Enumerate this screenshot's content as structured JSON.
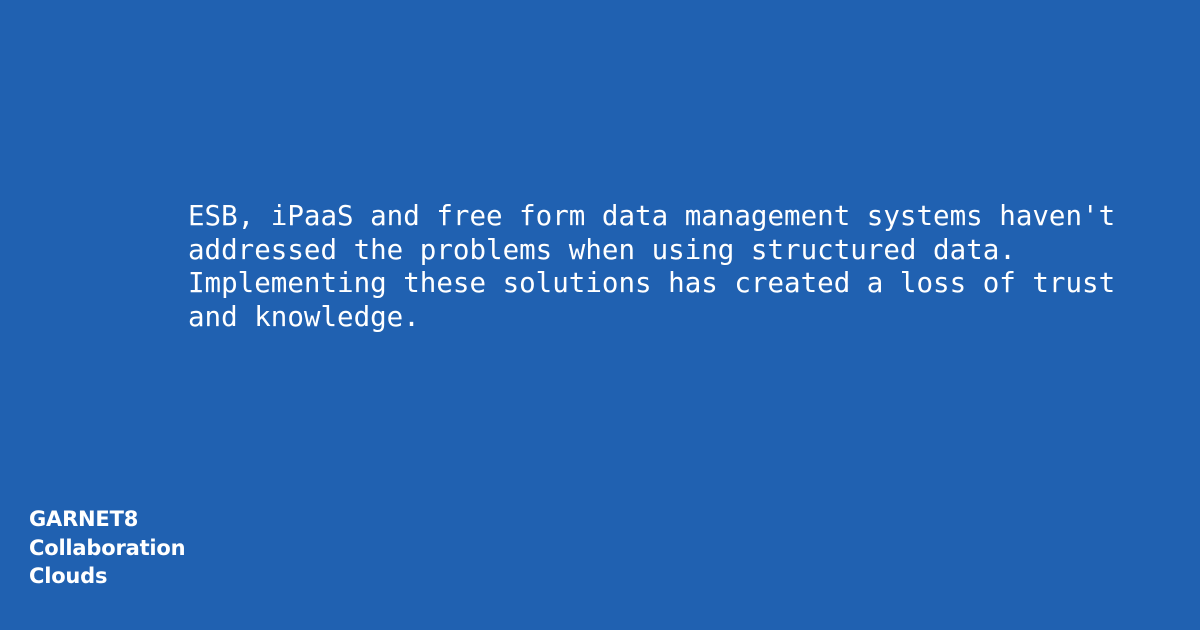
{
  "theme": {
    "background_color": "#2061b1",
    "text_color": "#ffffff"
  },
  "quote": {
    "lines": [
      "ESB, iPaaS and free form data management systems haven't",
      "addressed the problems when using structured data.",
      "Implementing these solutions has created a loss of trust",
      "and knowledge."
    ]
  },
  "brand": {
    "lines": [
      "GARNET8",
      "Collaboration",
      "Clouds"
    ]
  }
}
